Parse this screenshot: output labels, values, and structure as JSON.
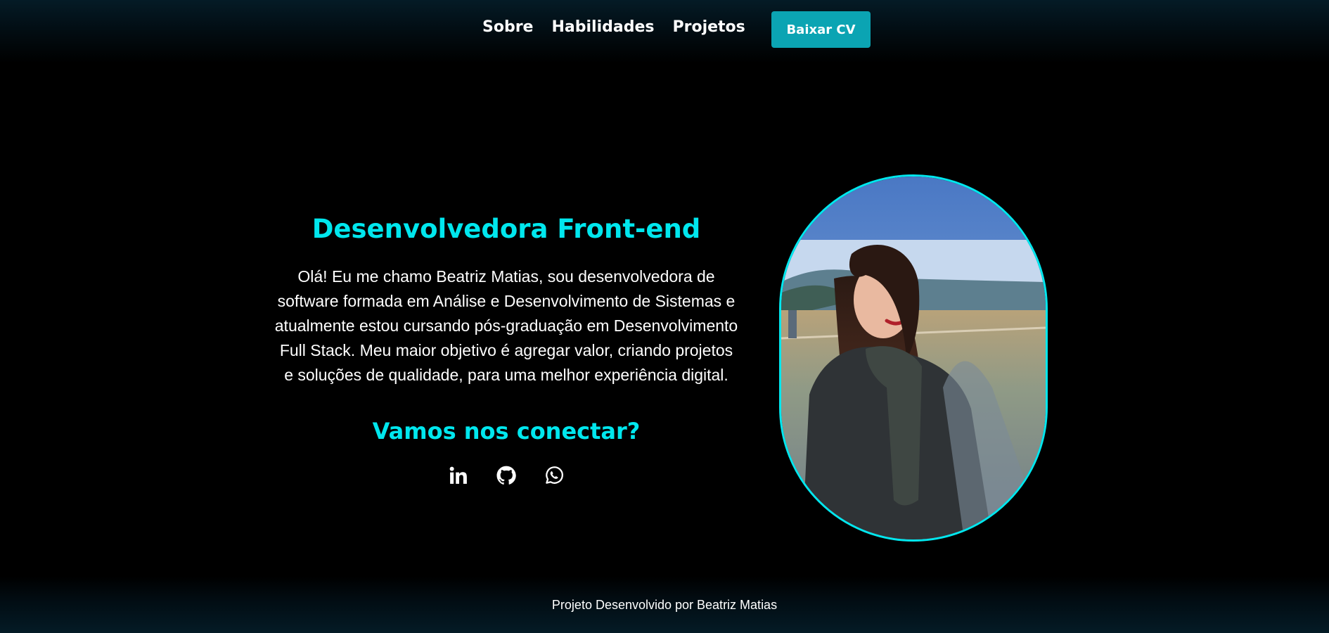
{
  "header": {
    "nav": [
      {
        "label": "Sobre"
      },
      {
        "label": "Habilidades"
      },
      {
        "label": "Projetos"
      }
    ],
    "cv_button": "Baixar CV"
  },
  "intro": {
    "title": "Desenvolvedora Front-end",
    "text": "Olá! Eu me chamo Beatriz Matias, sou desenvolvedora de software formada em Análise e Desenvolvimento de Sistemas e atualmente estou cursando pós-graduação em Desenvolvimento Full Stack. Meu maior objetivo é agregar valor, criando projetos e soluções de qualidade, para uma melhor experiência digital.",
    "connect_title": "Vamos nos conectar?",
    "social_icons": [
      "linkedin-icon",
      "github-icon",
      "whatsapp-icon"
    ]
  },
  "photo": {
    "description_icon": "profile-photo"
  },
  "footer": {
    "text": "Projeto Desenvolvido por Beatriz Matias"
  },
  "colors": {
    "accent": "#00e7ee",
    "button": "#0ba4b3",
    "background": "#000000",
    "header_gradient": "#041b26"
  }
}
